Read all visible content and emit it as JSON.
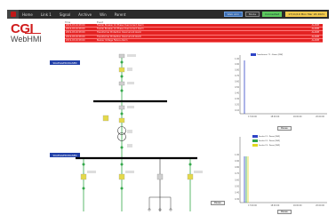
{
  "navbar": {
    "items": [
      "Home",
      "Link 1",
      "Signal",
      "Archive",
      "Win",
      "Parent"
    ],
    "btn_one": "Web Alm",
    "btn_two": "Mode",
    "status": "Connected",
    "time": "17/11/19 Mon Mar 26 2021"
  },
  "brand": {
    "logo": "CGI",
    "product": "WebHMI"
  },
  "alarms": {
    "headers": [
      "Time",
      "Event",
      ""
    ],
    "rows": [
      {
        "time": "2019-03-16 08:00",
        "event": "Feeder Breaker 10 Phase Overcurrent Alarm",
        "state": "ALARM"
      },
      {
        "time": "2019-03-16 08:00",
        "event": "Feeder Breaker 10 Phase Overcurrent Alarm",
        "state": "ALARM"
      },
      {
        "time": "2019-03-16 08:00",
        "event": "Transformer Protection Overcurrent Alarm",
        "state": "ALARM"
      },
      {
        "time": "2019-03-16 08:00",
        "event": "Transformer Protection Overcurrent Alarm",
        "state": "ALARM"
      },
      {
        "time": "2019-03-16 08:00",
        "event": "Busbar Voltage Failure Alarm",
        "state": "ALARM"
      }
    ]
  },
  "diagram": {
    "bus_top_label": "SKAEGGERUDASEN",
    "bus_bottom_label": "SKAEGGERUDASEN",
    "feeders_top": [
      "Q1",
      "Q2",
      "Q3"
    ],
    "feeders_bottom": [
      "F1",
      "F2",
      "F3",
      "F4"
    ]
  },
  "chart_top": {
    "legend": "Transformer T1 - Power [MW]",
    "ytick_labels": [
      "1.00",
      "0.90",
      "0.80",
      "0.70",
      "0.60",
      "0.50",
      "0.40",
      "0.30",
      "0.20",
      "0.10"
    ],
    "xtick_labels": [
      "17:00:00",
      "18:00:00",
      "19:00:00",
      "20:00:00"
    ],
    "button": "Pause"
  },
  "chart_bottom": {
    "legend": [
      "Feeder F1 - Power [MW]",
      "Feeder F2 - Power [MW]",
      "Feeder F3 - Power [MW]"
    ],
    "legend_colors": [
      "#2f44c6",
      "#2da34a",
      "#e1d820"
    ],
    "ytick_labels": [
      "1.00",
      "0.90",
      "0.80",
      "0.70",
      "0.60",
      "0.50",
      "0.40",
      "0.30"
    ],
    "xtick_labels": [
      "17:00:00",
      "18:00:00",
      "19:00:00",
      "20:00:00"
    ],
    "button": "Pause"
  },
  "center_button": "Pause",
  "colors": {
    "alarm": "#e32222",
    "bus_label": "#2140a8",
    "brand_red": "#d01c1c",
    "energized": "#33a84a",
    "active_device": "#e4d94a"
  }
}
